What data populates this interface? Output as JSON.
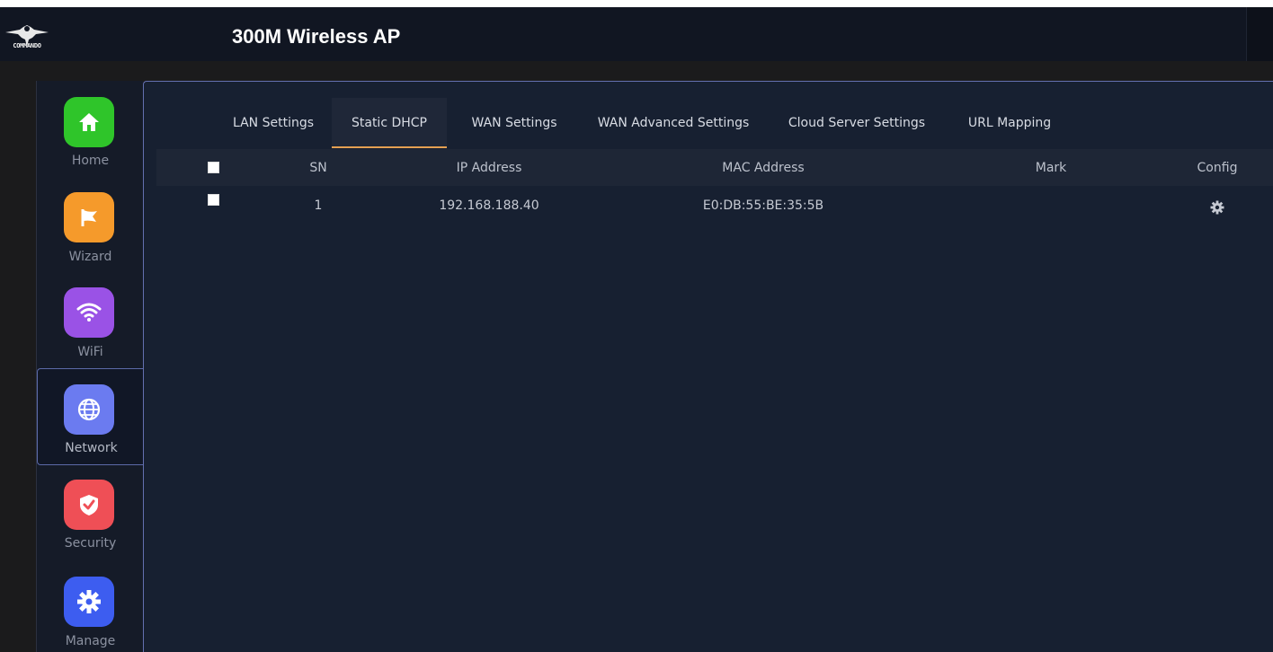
{
  "header": {
    "title": "300M Wireless AP",
    "logo_text": "COMMANDO"
  },
  "sidebar": {
    "items": [
      {
        "label": "Home",
        "icon": "home-icon",
        "color": "#2fc52a"
      },
      {
        "label": "Wizard",
        "icon": "flag-icon",
        "color": "#f59a2b"
      },
      {
        "label": "WiFi",
        "icon": "wifi-icon",
        "color": "#9a52e6"
      },
      {
        "label": "Network",
        "icon": "globe-icon",
        "color": "#6b7bf0",
        "active": true
      },
      {
        "label": "Security",
        "icon": "shield-icon",
        "color": "#ef4f56"
      },
      {
        "label": "Manage",
        "icon": "gear-icon",
        "color": "#3d5df0"
      }
    ]
  },
  "tabs": [
    {
      "label": "LAN Settings"
    },
    {
      "label": "Static DHCP",
      "active": true
    },
    {
      "label": "WAN Settings"
    },
    {
      "label": "WAN Advanced Settings"
    },
    {
      "label": "Cloud Server Settings"
    },
    {
      "label": "URL Mapping"
    }
  ],
  "table": {
    "columns": [
      "SN",
      "IP Address",
      "MAC Address",
      "Mark",
      "Config"
    ],
    "rows": [
      {
        "sn": "1",
        "ip": "192.168.188.40",
        "mac": "E0:DB:55:BE:35:5B",
        "mark": "",
        "config_icon": "gear-icon"
      }
    ]
  },
  "colors": {
    "accent_tab_underline": "#e4a052",
    "active_border": "#5c6aa8",
    "panel_bg": "#172031"
  }
}
